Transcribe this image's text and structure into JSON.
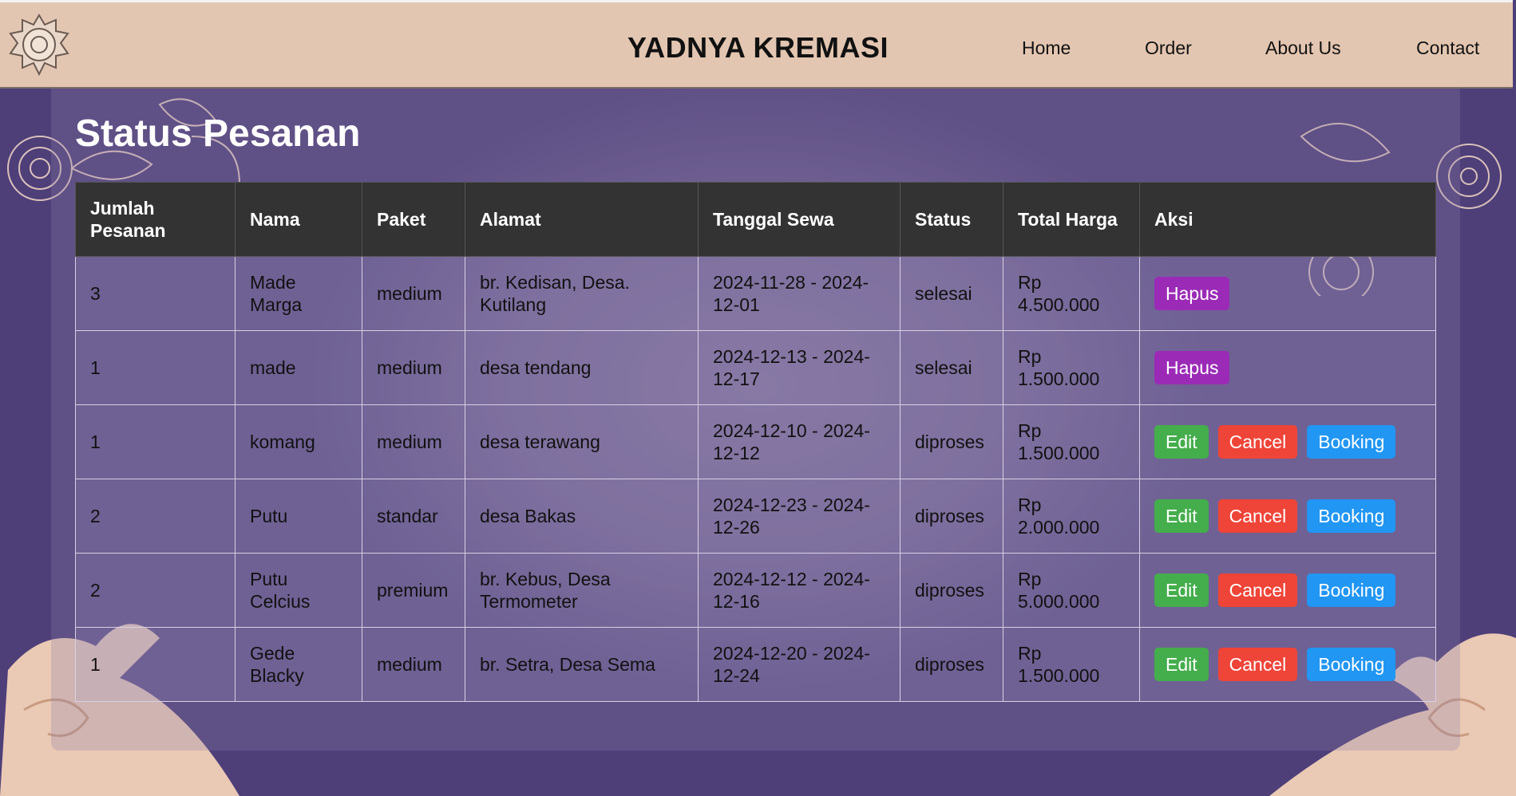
{
  "header": {
    "brand": "YADNYA KREMASI",
    "nav": [
      "Home",
      "Order",
      "About Us",
      "Contact"
    ]
  },
  "page": {
    "title": "Status Pesanan"
  },
  "table": {
    "headers": [
      "Jumlah Pesanan",
      "Nama",
      "Paket",
      "Alamat",
      "Tanggal Sewa",
      "Status",
      "Total Harga",
      "Aksi"
    ],
    "rows": [
      {
        "jumlah": "3",
        "nama": "Made Marga",
        "paket": "medium",
        "alamat": "br. Kedisan, Desa. Kutilang",
        "tanggal": "2024-11-28 - 2024-12-01",
        "status": "selesai",
        "total": "Rp 4.500.000",
        "actions": [
          "Hapus"
        ]
      },
      {
        "jumlah": "1",
        "nama": "made",
        "paket": "medium",
        "alamat": "desa tendang",
        "tanggal": "2024-12-13 - 2024-12-17",
        "status": "selesai",
        "total": "Rp 1.500.000",
        "actions": [
          "Hapus"
        ]
      },
      {
        "jumlah": "1",
        "nama": "komang",
        "paket": "medium",
        "alamat": "desa terawang",
        "tanggal": "2024-12-10 - 2024-12-12",
        "status": "diproses",
        "total": "Rp 1.500.000",
        "actions": [
          "Edit",
          "Cancel",
          "Booking"
        ]
      },
      {
        "jumlah": "2",
        "nama": "Putu",
        "paket": "standar",
        "alamat": "desa Bakas",
        "tanggal": "2024-12-23 - 2024-12-26",
        "status": "diproses",
        "total": "Rp 2.000.000",
        "actions": [
          "Edit",
          "Cancel",
          "Booking"
        ]
      },
      {
        "jumlah": "2",
        "nama": "Putu Celcius",
        "paket": "premium",
        "alamat": "br. Kebus, Desa Termometer",
        "tanggal": "2024-12-12 - 2024-12-16",
        "status": "diproses",
        "total": "Rp 5.000.000",
        "actions": [
          "Edit",
          "Cancel",
          "Booking"
        ]
      },
      {
        "jumlah": "1",
        "nama": "Gede Blacky",
        "paket": "medium",
        "alamat": "br. Setra, Desa Sema",
        "tanggal": "2024-12-20 - 2024-12-24",
        "status": "diproses",
        "total": "Rp 1.500.000",
        "actions": [
          "Edit",
          "Cancel",
          "Booking"
        ]
      }
    ]
  },
  "colors": {
    "header_bg": "#e3c6b1",
    "page_bg": "#4d3f78",
    "hapus": "#9b2bb7",
    "edit": "#44ad4c",
    "cancel": "#ef4438",
    "booking": "#2196f3"
  },
  "icons": [
    "logo-emblem-icon",
    "floral-ornament",
    "wave-ornament"
  ]
}
